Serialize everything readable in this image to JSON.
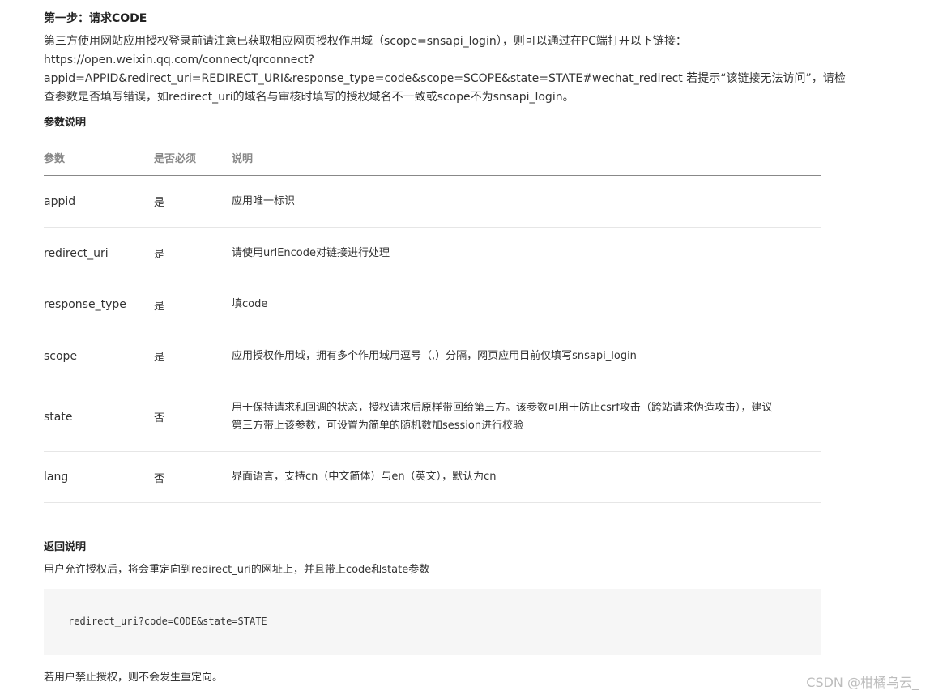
{
  "section": {
    "step_title": "第一步：请求CODE",
    "intro_lines": [
      "第三方使用网站应用授权登录前请注意已获取相应网页授权作用域（scope=snsapi_login），则可以通过在PC端打开以下链接：",
      "https://open.weixin.qq.com/connect/qrconnect?",
      "appid=APPID&redirect_uri=REDIRECT_URI&response_type=code&scope=SCOPE&state=STATE#wechat_redirect 若提示“该链接无法访问”，请检",
      "查参数是否填写错误，如redirect_uri的域名与审核时填写的授权域名不一致或scope不为snsapi_login。"
    ]
  },
  "params": {
    "title": "参数说明",
    "headers": [
      "参数",
      "是否必须",
      "说明"
    ],
    "rows": [
      {
        "name": "appid",
        "required": "是",
        "desc": [
          "应用唯一标识"
        ]
      },
      {
        "name": "redirect_uri",
        "required": "是",
        "desc": [
          "请使用urlEncode对链接进行处理"
        ]
      },
      {
        "name": "response_type",
        "required": "是",
        "desc": [
          "填code"
        ]
      },
      {
        "name": "scope",
        "required": "是",
        "desc": [
          "应用授权作用域，拥有多个作用域用逗号（,）分隔，网页应用目前仅填写snsapi_login"
        ]
      },
      {
        "name": "state",
        "required": "否",
        "desc": [
          "用于保持请求和回调的状态，授权请求后原样带回给第三方。该参数可用于防止csrf攻击（跨站请求伪造攻击），建议",
          "第三方带上该参数，可设置为简单的随机数加session进行校验"
        ]
      },
      {
        "name": "lang",
        "required": "否",
        "desc": [
          "界面语言，支持cn（中文简体）与en（英文），默认为cn"
        ]
      }
    ]
  },
  "return_section": {
    "title": "返回说明",
    "desc": "用户允许授权后，将会重定向到redirect_uri的网址上，并且带上code和state参数",
    "code": "redirect_uri?code=CODE&state=STATE",
    "deny_note": "若用户禁止授权，则不会发生重定向。"
  },
  "watermark": "CSDN @柑橘乌云_"
}
